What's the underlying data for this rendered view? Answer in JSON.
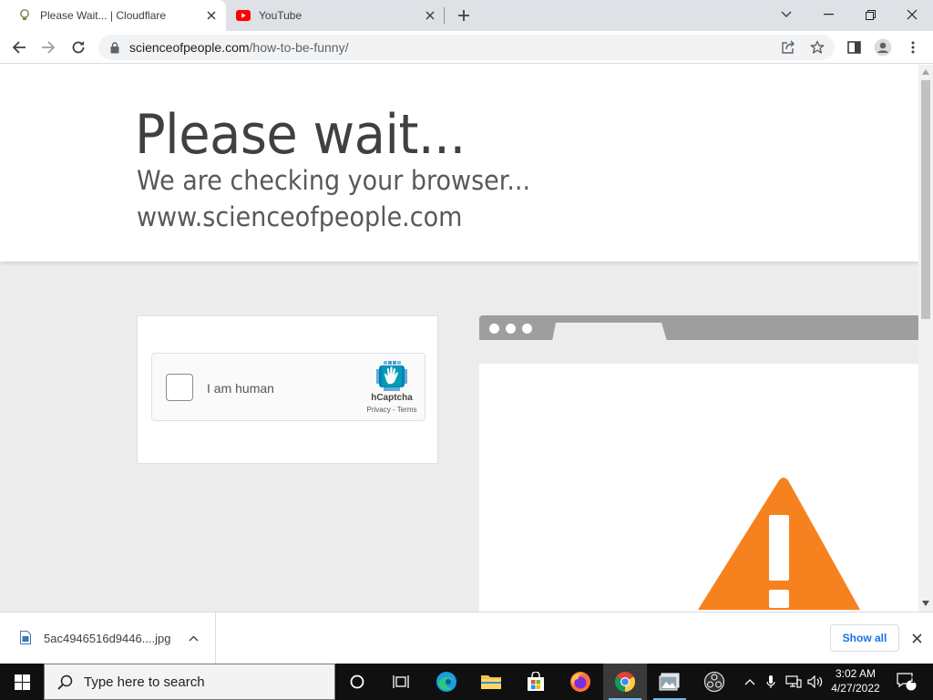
{
  "browser": {
    "tabs": [
      {
        "title": "Please Wait... | Cloudflare",
        "active": true
      },
      {
        "title": "YouTube",
        "active": false
      }
    ],
    "url_domain": "scienceofpeople.com",
    "url_path": "/how-to-be-funny/"
  },
  "page": {
    "heading": "Please wait...",
    "subheading": "We are checking your browser...",
    "domain": "www.scienceofpeople.com",
    "captcha": {
      "label": "I am human",
      "brand": "hCaptcha",
      "links": "Privacy - Terms"
    }
  },
  "download_shelf": {
    "filename": "5ac4946516d9446....jpg",
    "show_all": "Show all"
  },
  "taskbar": {
    "search_placeholder": "Type here to search",
    "time": "3:02 AM",
    "date": "4/27/2022",
    "notification_count": "1"
  },
  "colors": {
    "warning": "#f6821f",
    "hcaptcha_blue": "#0074bf",
    "youtube_red": "#ff0000"
  }
}
